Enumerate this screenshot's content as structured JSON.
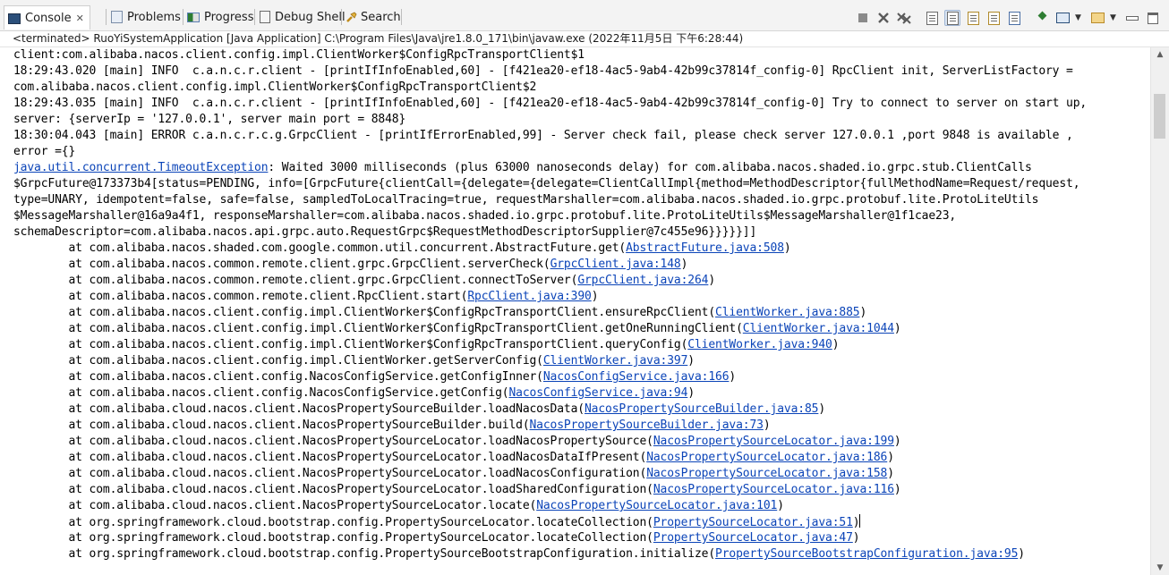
{
  "tabs": [
    {
      "label": "Console",
      "icon": "console-icon",
      "active": true,
      "close": "✕"
    },
    {
      "label": "Problems",
      "icon": "problems-icon"
    },
    {
      "label": "Progress",
      "icon": "progress-icon"
    },
    {
      "label": "Debug Shell",
      "icon": "debug-shell-icon"
    },
    {
      "label": "Search",
      "icon": "search-icon"
    }
  ],
  "toolbar": {
    "icons": [
      "terminate-icon",
      "remove-launch-icon",
      "remove-all-terminated-icon",
      "scroll-lock-icon",
      "word-wrap-icon",
      "show-on-stdout-icon",
      "show-on-stderr-icon",
      "pin-console-icon",
      "display-selected-console-icon",
      "open-console-icon",
      "minimize-icon",
      "maximize-icon"
    ]
  },
  "status": "<terminated> RuoYiSystemApplication [Java Application] C:\\Program Files\\Java\\jre1.8.0_171\\bin\\javaw.exe (2022年11月5日 下午6:28:44)",
  "console": {
    "lines": [
      {
        "text": "client:com.alibaba.nacos.client.config.impl.ClientWorker$ConfigRpcTransportClient$1"
      },
      {
        "text": "18:29:43.020 [main] INFO  c.a.n.c.r.client - [printIfInfoEnabled,60] - [f421ea20-ef18-4ac5-9ab4-42b99c37814f_config-0] RpcClient init, ServerListFactory ="
      },
      {
        "text": "com.alibaba.nacos.client.config.impl.ClientWorker$ConfigRpcTransportClient$2"
      },
      {
        "text": "18:29:43.035 [main] INFO  c.a.n.c.r.client - [printIfInfoEnabled,60] - [f421ea20-ef18-4ac5-9ab4-42b99c37814f_config-0] Try to connect to server on start up,"
      },
      {
        "text": "server: {serverIp = '127.0.0.1', server main port = 8848}"
      },
      {
        "text": "18:30:04.043 [main] ERROR c.a.n.c.r.c.g.GrpcClient - [printIfErrorEnabled,99] - Server check fail, please check server 127.0.0.1 ,port 9848 is available ,"
      },
      {
        "text": "error ={}"
      },
      {
        "link": "java.util.concurrent.TimeoutException",
        "text": ": Waited 3000 milliseconds (plus 63000 nanoseconds delay) for com.alibaba.nacos.shaded.io.grpc.stub.ClientCalls"
      },
      {
        "text": "$GrpcFuture@173373b4[status=PENDING, info=[GrpcFuture{clientCall={delegate={delegate=ClientCallImpl{method=MethodDescriptor{fullMethodName=Request/request,"
      },
      {
        "text": "type=UNARY, idempotent=false, safe=false, sampledToLocalTracing=true, requestMarshaller=com.alibaba.nacos.shaded.io.grpc.protobuf.lite.ProtoLiteUtils"
      },
      {
        "text": "$MessageMarshaller@16a9a4f1, responseMarshaller=com.alibaba.nacos.shaded.io.grpc.protobuf.lite.ProtoLiteUtils$MessageMarshaller@1f1cae23,"
      },
      {
        "text": "schemaDescriptor=com.alibaba.nacos.api.grpc.auto.RequestGrpc$RequestMethodDescriptorSupplier@7c455e96}}}}}]]"
      },
      {
        "pre": "\tat com.alibaba.nacos.shaded.com.google.common.util.concurrent.AbstractFuture.get(",
        "link": "AbstractFuture.java:508",
        "post": ")"
      },
      {
        "pre": "\tat com.alibaba.nacos.common.remote.client.grpc.GrpcClient.serverCheck(",
        "link": "GrpcClient.java:148",
        "post": ")"
      },
      {
        "pre": "\tat com.alibaba.nacos.common.remote.client.grpc.GrpcClient.connectToServer(",
        "link": "GrpcClient.java:264",
        "post": ")"
      },
      {
        "pre": "\tat com.alibaba.nacos.common.remote.client.RpcClient.start(",
        "link": "RpcClient.java:390",
        "post": ")"
      },
      {
        "pre": "\tat com.alibaba.nacos.client.config.impl.ClientWorker$ConfigRpcTransportClient.ensureRpcClient(",
        "link": "ClientWorker.java:885",
        "post": ")"
      },
      {
        "pre": "\tat com.alibaba.nacos.client.config.impl.ClientWorker$ConfigRpcTransportClient.getOneRunningClient(",
        "link": "ClientWorker.java:1044",
        "post": ")"
      },
      {
        "pre": "\tat com.alibaba.nacos.client.config.impl.ClientWorker$ConfigRpcTransportClient.queryConfig(",
        "link": "ClientWorker.java:940",
        "post": ")"
      },
      {
        "pre": "\tat com.alibaba.nacos.client.config.impl.ClientWorker.getServerConfig(",
        "link": "ClientWorker.java:397",
        "post": ")"
      },
      {
        "pre": "\tat com.alibaba.nacos.client.config.NacosConfigService.getConfigInner(",
        "link": "NacosConfigService.java:166",
        "post": ")"
      },
      {
        "pre": "\tat com.alibaba.nacos.client.config.NacosConfigService.getConfig(",
        "link": "NacosConfigService.java:94",
        "post": ")"
      },
      {
        "pre": "\tat com.alibaba.cloud.nacos.client.NacosPropertySourceBuilder.loadNacosData(",
        "link": "NacosPropertySourceBuilder.java:85",
        "post": ")"
      },
      {
        "pre": "\tat com.alibaba.cloud.nacos.client.NacosPropertySourceBuilder.build(",
        "link": "NacosPropertySourceBuilder.java:73",
        "post": ")"
      },
      {
        "pre": "\tat com.alibaba.cloud.nacos.client.NacosPropertySourceLocator.loadNacosPropertySource(",
        "link": "NacosPropertySourceLocator.java:199",
        "post": ")"
      },
      {
        "pre": "\tat com.alibaba.cloud.nacos.client.NacosPropertySourceLocator.loadNacosDataIfPresent(",
        "link": "NacosPropertySourceLocator.java:186",
        "post": ")"
      },
      {
        "pre": "\tat com.alibaba.cloud.nacos.client.NacosPropertySourceLocator.loadNacosConfiguration(",
        "link": "NacosPropertySourceLocator.java:158",
        "post": ")"
      },
      {
        "pre": "\tat com.alibaba.cloud.nacos.client.NacosPropertySourceLocator.loadSharedConfiguration(",
        "link": "NacosPropertySourceLocator.java:116",
        "post": ")"
      },
      {
        "pre": "\tat com.alibaba.cloud.nacos.client.NacosPropertySourceLocator.locate(",
        "link": "NacosPropertySourceLocator.java:101",
        "post": ")"
      },
      {
        "pre": "\tat org.springframework.cloud.bootstrap.config.PropertySourceLocator.locateCollection(",
        "link": "PropertySourceLocator.java:51",
        "post": ")",
        "caret": true
      },
      {
        "pre": "\tat org.springframework.cloud.bootstrap.config.PropertySourceLocator.locateCollection(",
        "link": "PropertySourceLocator.java:47",
        "post": ")"
      },
      {
        "pre": "\tat org.springframework.cloud.bootstrap.config.PropertySourceBootstrapConfiguration.initialize(",
        "link": "PropertySourceBootstrapConfiguration.java:95",
        "post": ")"
      }
    ]
  },
  "colors": {
    "link": "#0b44b8",
    "text": "#000000",
    "tabbar": "#f3f3f3"
  }
}
